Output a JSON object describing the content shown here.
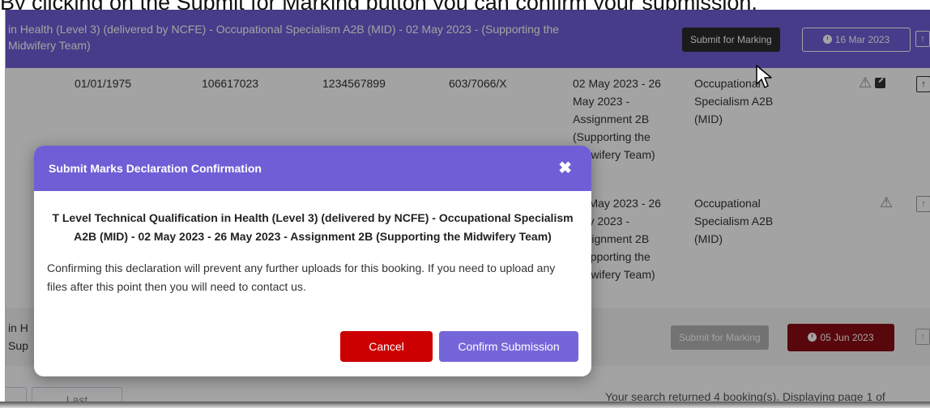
{
  "caption": "By clicking on the Submit for Marking button you can confirm your submission.",
  "header_row": {
    "title": "in Health (Level 3) (delivered by NCFE) - Occupational Specialism A2B (MID) - 02 May 2023 - (Supporting the Midwifery Team)",
    "submit_label": "Submit for Marking",
    "date": "16 Mar 2023",
    "upload_icon": "upload-icon"
  },
  "rows": [
    {
      "dob": "01/01/1975",
      "candidate_no": "106617023",
      "uln": "1234567899",
      "qual_no": "603/7066/X",
      "period": "02 May 2023 - 26 May 2023 - Assignment 2B (Supporting the Midwifery Team)",
      "component": "Occupational Specialism A2B (MID)"
    },
    {
      "period": "02 May 2023 - 26 May 2023 - Assignment 2B (Supporting the Midwifery Team)",
      "component": "Occupational Specialism A2B (MID)"
    }
  ],
  "row3": {
    "title": "in H Sup",
    "submit_label": "Submit for Marking",
    "date": "05 Jun 2023"
  },
  "pager": {
    "last_label": "Last",
    "info": "Your search returned 4 booking(s). Displaying page 1 of"
  },
  "modal": {
    "title": "Submit Marks Declaration Confirmation",
    "close_symbol": "✖",
    "qualification": "T Level Technical Qualification in Health (Level 3) (delivered by NCFE) - Occupational Specialism A2B (MID) - 02 May 2023 - 26 May 2023 - Assignment 2B (Supporting the Midwifery Team)",
    "message": "Confirming this declaration will prevent any further uploads for this booking. If you need to upload any files after this point then you will need to contact us.",
    "cancel_label": "Cancel",
    "confirm_label": "Confirm Submission"
  },
  "colors": {
    "accent": "#6e5fd6",
    "cancel": "#cc0000",
    "overdue": "#8a0d14"
  }
}
